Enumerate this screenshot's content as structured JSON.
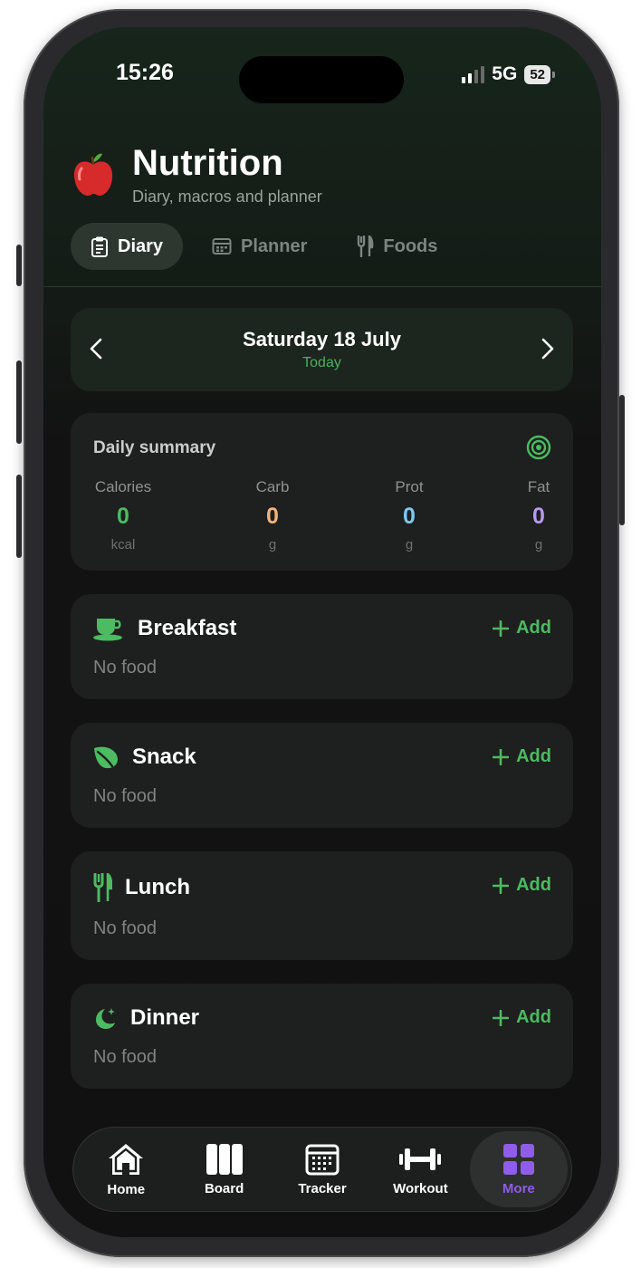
{
  "status": {
    "time": "15:26",
    "network": "5G",
    "battery": "52"
  },
  "header": {
    "title": "Nutrition",
    "subtitle": "Diary, macros and planner",
    "icon": "apple-icon"
  },
  "tabs": [
    {
      "label": "Diary",
      "icon": "clipboard-icon",
      "active": true
    },
    {
      "label": "Planner",
      "icon": "calendar-icon",
      "active": false
    },
    {
      "label": "Foods",
      "icon": "utensils-icon",
      "active": false
    }
  ],
  "date": {
    "label": "Saturday 18 July",
    "sub": "Today"
  },
  "summary": {
    "title": "Daily summary",
    "macros": [
      {
        "label": "Calories",
        "value": "0",
        "unit": "kcal",
        "color": "#4cbb61"
      },
      {
        "label": "Carb",
        "value": "0",
        "unit": "g",
        "color": "#f2b47a"
      },
      {
        "label": "Prot",
        "value": "0",
        "unit": "g",
        "color": "#7fc8f0"
      },
      {
        "label": "Fat",
        "value": "0",
        "unit": "g",
        "color": "#b89af0"
      }
    ]
  },
  "meals": [
    {
      "name": "Breakfast",
      "icon": "cup-icon",
      "empty": "No food",
      "add": "Add"
    },
    {
      "name": "Snack",
      "icon": "leaf-icon",
      "empty": "No food",
      "add": "Add"
    },
    {
      "name": "Lunch",
      "icon": "utensils-icon",
      "empty": "No food",
      "add": "Add"
    },
    {
      "name": "Dinner",
      "icon": "moon-icon",
      "empty": "No food",
      "add": "Add"
    }
  ],
  "nav": [
    {
      "label": "Home",
      "icon": "home-icon",
      "active": false
    },
    {
      "label": "Board",
      "icon": "board-icon",
      "active": false
    },
    {
      "label": "Tracker",
      "icon": "calendar-grid-icon",
      "active": false
    },
    {
      "label": "Workout",
      "icon": "dumbbell-icon",
      "active": false
    },
    {
      "label": "More",
      "icon": "grid-icon",
      "active": true
    }
  ],
  "colors": {
    "accent": "#4cbb61",
    "nav_active": "#8f5de8",
    "background": "#121212",
    "card": "#1e1f1f"
  }
}
